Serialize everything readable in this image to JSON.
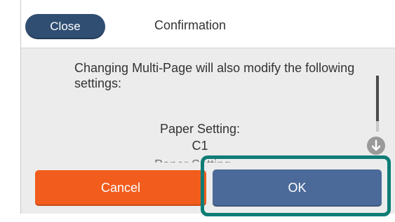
{
  "header": {
    "close_label": "Close",
    "title": "Confirmation"
  },
  "dialog": {
    "message": "Changing Multi-Page will also modify the following settings:",
    "setting_name": "Paper Setting:",
    "setting_value": "C1",
    "partial_next_line": "Paper Setting..."
  },
  "buttons": {
    "cancel_label": "Cancel",
    "ok_label": "OK"
  },
  "scroll": {
    "down_icon": "arrow-down-icon"
  },
  "colors": {
    "close_button": "#2f4e72",
    "cancel_button": "#f25c1c",
    "ok_button": "#4c6a99",
    "highlight_frame": "#0e7d76"
  }
}
